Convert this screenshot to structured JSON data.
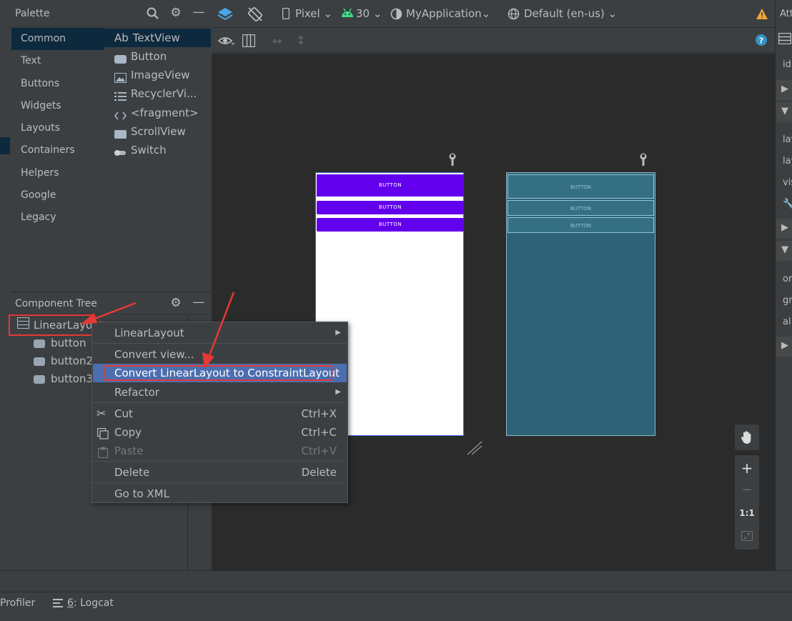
{
  "palette": {
    "title": "Palette",
    "categories": [
      "Common",
      "Text",
      "Buttons",
      "Widgets",
      "Layouts",
      "Containers",
      "Helpers",
      "Google",
      "Legacy"
    ],
    "items": [
      {
        "icon": "textview-icon",
        "prefix": "Ab",
        "label": "TextView"
      },
      {
        "icon": "button-icon",
        "label": "Button"
      },
      {
        "icon": "image-icon",
        "label": "ImageView"
      },
      {
        "icon": "list-icon",
        "label": "RecyclerVi..."
      },
      {
        "icon": "code-icon",
        "label": "<fragment>"
      },
      {
        "icon": "scrollview-icon",
        "label": "ScrollView"
      },
      {
        "icon": "switch-icon",
        "label": "Switch"
      }
    ]
  },
  "component_tree": {
    "title": "Component Tree",
    "root": "LinearLayout",
    "children": [
      "button",
      "button2",
      "button3"
    ]
  },
  "toolbar": {
    "device": "Pixel",
    "api": "30",
    "theme": "MyApplication",
    "locale": "Default (en-us)"
  },
  "design": {
    "buttons": [
      "BUTTON",
      "BUTTON",
      "BUTTON"
    ]
  },
  "attributes": {
    "title": "Att",
    "rows": [
      "id",
      "lay",
      "lay",
      "vis",
      "or",
      "gr",
      "al"
    ]
  },
  "context_menu": {
    "items": [
      {
        "label": "LinearLayout",
        "shortcut": "",
        "submenu": true
      },
      {
        "label": "Convert view...",
        "shortcut": ""
      },
      {
        "label": "Convert LinearLayout to ConstraintLayout",
        "shortcut": "",
        "highlighted": true
      },
      {
        "label": "Refactor",
        "shortcut": "",
        "submenu": true
      },
      {
        "label": "Cut",
        "shortcut": "Ctrl+X"
      },
      {
        "label": "Copy",
        "shortcut": "Ctrl+C"
      },
      {
        "label": "Paste",
        "shortcut": "Ctrl+V",
        "disabled": true
      },
      {
        "label": "Delete",
        "shortcut": "Delete"
      },
      {
        "label": "Go to XML",
        "shortcut": ""
      }
    ]
  },
  "zoom": {
    "one_to_one": "1:1"
  },
  "bottom_bar": {
    "profiler": "Profiler",
    "logcat_num": "6",
    "logcat": ": Logcat"
  },
  "colors": {
    "accent": "#6200ee",
    "selection": "#4b6eaf",
    "annotation": "#e53935"
  }
}
